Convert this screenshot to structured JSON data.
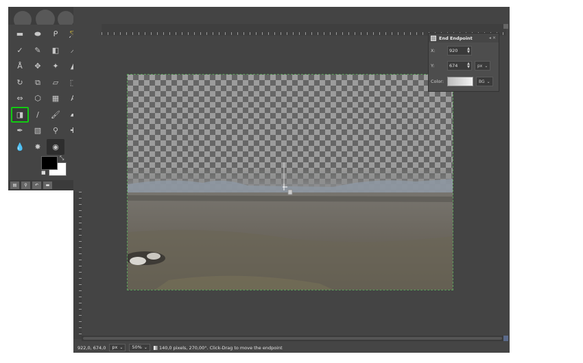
{
  "toolbox": {
    "tools": [
      {
        "name": "rect-select-icon",
        "glyph": "▬"
      },
      {
        "name": "ellipse-select-icon",
        "glyph": "⬬"
      },
      {
        "name": "free-select-icon",
        "glyph": "ᑭ"
      },
      {
        "name": "fuzzy-select-icon",
        "glyph": "🪄"
      },
      {
        "name": "select-by-color-icon",
        "glyph": "▚"
      },
      {
        "name": "paths-icon",
        "glyph": "✓"
      },
      {
        "name": "color-picker-icon",
        "glyph": "✎"
      },
      {
        "name": "foreground-select-icon",
        "glyph": "◧"
      },
      {
        "name": "measure-icon",
        "glyph": "⟋"
      },
      {
        "name": "zoom-icon",
        "glyph": "🔍"
      },
      {
        "name": "scissors-select-icon",
        "glyph": "Å"
      },
      {
        "name": "move-icon",
        "glyph": "✥"
      },
      {
        "name": "align-icon",
        "glyph": "✦"
      },
      {
        "name": "crop-icon",
        "glyph": "▲"
      },
      {
        "name": "unified-transform-icon",
        "glyph": "⌗"
      },
      {
        "name": "rotate-icon",
        "glyph": "↻"
      },
      {
        "name": "scale-icon",
        "glyph": "⧉"
      },
      {
        "name": "shear-icon",
        "glyph": "▱"
      },
      {
        "name": "perspective-icon",
        "glyph": "⬚"
      },
      {
        "name": "warp-icon",
        "glyph": "◭"
      },
      {
        "name": "flip-icon",
        "glyph": "⇔"
      },
      {
        "name": "cage-transform-icon",
        "glyph": "⬡"
      },
      {
        "name": "handle-transform-icon",
        "glyph": "▦"
      },
      {
        "name": "text-icon",
        "glyph": "A"
      },
      {
        "name": "bucket-fill-icon",
        "glyph": "◆"
      },
      {
        "name": "gradient-icon",
        "glyph": "◨",
        "active": true
      },
      {
        "name": "pencil-icon",
        "glyph": "/"
      },
      {
        "name": "paintbrush-icon",
        "glyph": "🖌"
      },
      {
        "name": "eraser-icon",
        "glyph": "▰"
      },
      {
        "name": "airbrush-icon",
        "glyph": "✕"
      },
      {
        "name": "ink-icon",
        "glyph": "✒"
      },
      {
        "name": "mypaint-brush-icon",
        "glyph": "▧"
      },
      {
        "name": "clone-icon",
        "glyph": "⚲"
      },
      {
        "name": "heal-icon",
        "glyph": "✚"
      },
      {
        "name": "perspective-clone-icon",
        "glyph": "⧈"
      },
      {
        "name": "smudge-icon",
        "glyph": "💧"
      },
      {
        "name": "blur-icon",
        "glyph": "✸"
      },
      {
        "name": "dodge-burn-icon",
        "glyph": "◉",
        "selected": true
      }
    ],
    "colors": {
      "foreground": "#000000",
      "background": "#ffffff"
    }
  },
  "ruler": {
    "labels": [
      "",
      "",
      "",
      "",
      "",
      "",
      "",
      "",
      "",
      "",
      "",
      "",
      ""
    ]
  },
  "status": {
    "coords": "922,0, 674,0",
    "unit": "px",
    "zoom": "50%",
    "message": "140,0 pixels, 270,00°. Click-Drag to move the endpoint"
  },
  "dialog": {
    "title": "End Endpoint",
    "x_label": "X:",
    "x_value": "920",
    "y_label": "Y:",
    "y_value": "674",
    "unit": "px",
    "color_label": "Color:",
    "color_value": "BG"
  },
  "colors": {
    "active_tool_outline": "#12cc12",
    "canvas_border": "#5aa05a"
  }
}
